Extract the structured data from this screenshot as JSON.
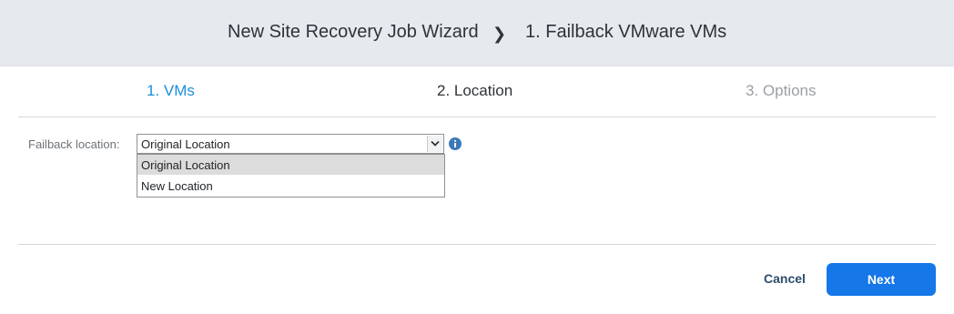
{
  "header": {
    "wizard_title": "New Site Recovery Job Wizard",
    "separator": "❯",
    "page_title": "1. Failback VMware VMs"
  },
  "steps": [
    {
      "label": "1. VMs",
      "state": "completed"
    },
    {
      "label": "2. Location",
      "state": "current"
    },
    {
      "label": "3. Options",
      "state": "upcoming"
    }
  ],
  "form": {
    "failback_location": {
      "label": "Failback location:",
      "selected": "Original Location",
      "options": [
        "Original Location",
        "New Location"
      ],
      "info_icon": "info-circle-icon"
    }
  },
  "footer": {
    "cancel_label": "Cancel",
    "next_label": "Next"
  },
  "colors": {
    "header_bg": "#e6e9ee",
    "active_step": "#1a8fd8",
    "next_button": "#1577e8",
    "cancel_text": "#2f4d6b"
  }
}
